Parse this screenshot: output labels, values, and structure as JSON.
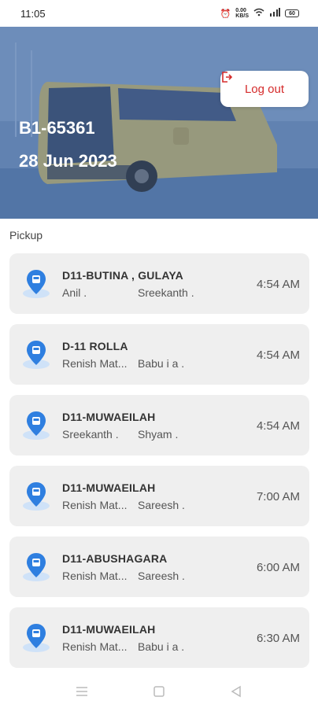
{
  "status": {
    "time": "11:05",
    "net_speed": "0.00\nKB/S",
    "battery": "60"
  },
  "header": {
    "bus_id": "B1-65361",
    "date": "28 Jun 2023",
    "logout_label": "Log out"
  },
  "section": {
    "title": "Pickup"
  },
  "trips": [
    {
      "route": "D11-BUTINA , GULAYA",
      "driver": "Anil .",
      "helper": "Sreekanth .",
      "time": "4:54 AM"
    },
    {
      "route": "D-11 ROLLA",
      "driver": "Renish Mat...",
      "helper": "Babu i a .",
      "time": "4:54 AM"
    },
    {
      "route": "D11-MUWAEILAH",
      "driver": "Sreekanth .",
      "helper": "Shyam .",
      "time": "4:54 AM"
    },
    {
      "route": "D11-MUWAEILAH",
      "driver": "Renish Mat...",
      "helper": "Sareesh .",
      "time": "7:00 AM"
    },
    {
      "route": "D11-ABUSHAGARA",
      "driver": "Renish Mat...",
      "helper": "Sareesh .",
      "time": "6:00 AM"
    },
    {
      "route": "D11-MUWAEILAH",
      "driver": "Renish Mat...",
      "helper": "Babu i a .",
      "time": "6:30 AM"
    }
  ],
  "colors": {
    "accent": "#2f7fe0",
    "logout": "#d52b2b",
    "card_bg": "#efefef"
  }
}
